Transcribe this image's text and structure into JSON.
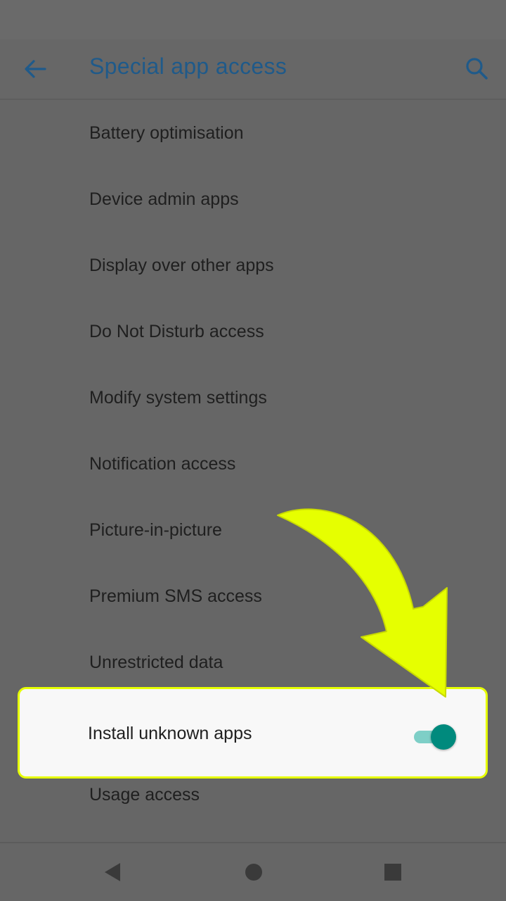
{
  "header": {
    "title": "Special app access",
    "back_icon": "arrow-left-icon",
    "search_icon": "search-icon"
  },
  "list": {
    "items": [
      {
        "label": "Battery optimisation"
      },
      {
        "label": "Device admin apps"
      },
      {
        "label": "Display over other apps"
      },
      {
        "label": "Do Not Disturb access"
      },
      {
        "label": "Modify system settings"
      },
      {
        "label": "Notification access"
      },
      {
        "label": "Picture-in-picture"
      },
      {
        "label": "Premium SMS access"
      },
      {
        "label": "Unrestricted data"
      }
    ],
    "highlighted": {
      "label": "Install unknown apps",
      "toggle_on": true
    },
    "after": {
      "label": "Usage access"
    }
  },
  "annotation": {
    "arrow_icon": "curved-arrow-icon",
    "arrow_color": "#e6ff00"
  },
  "nav": {
    "back_icon": "triangle-back-icon",
    "home_icon": "circle-home-icon",
    "recents_icon": "square-recents-icon"
  },
  "colors": {
    "toggle_thumb": "#008a7d",
    "toggle_track": "#7ecfc7",
    "title": "#1f5a8a"
  }
}
